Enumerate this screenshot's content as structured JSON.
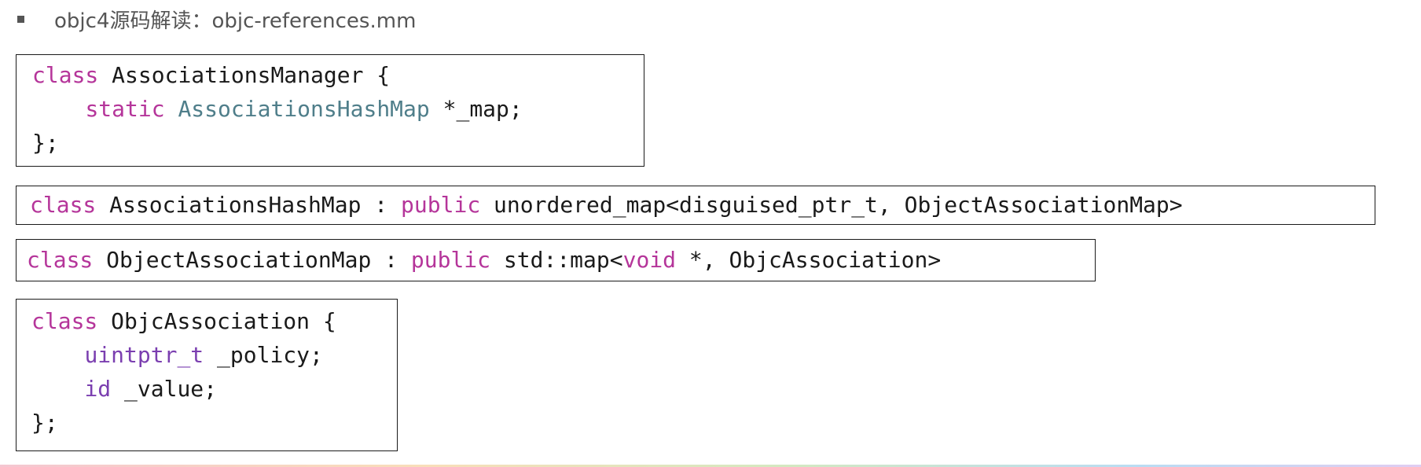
{
  "heading": {
    "text": "objc4源码解读：objc-references.mm"
  },
  "code_blocks": [
    {
      "lines": [
        [
          {
            "text": "class",
            "style": "kw"
          },
          {
            "text": " AssociationsManager {",
            "style": "plain"
          }
        ],
        [
          {
            "text": "    ",
            "style": "plain"
          },
          {
            "text": "static",
            "style": "kw"
          },
          {
            "text": " ",
            "style": "plain"
          },
          {
            "text": "AssociationsHashMap",
            "style": "type-teal"
          },
          {
            "text": " *_map;",
            "style": "plain"
          }
        ],
        [
          {
            "text": "};",
            "style": "plain"
          }
        ]
      ]
    },
    {
      "lines": [
        [
          {
            "text": "class",
            "style": "kw"
          },
          {
            "text": " AssociationsHashMap : ",
            "style": "plain"
          },
          {
            "text": "public",
            "style": "kw"
          },
          {
            "text": " unordered_map<disguised_ptr_t, ObjectAssociationMap>",
            "style": "plain"
          }
        ]
      ]
    },
    {
      "lines": [
        [
          {
            "text": "class",
            "style": "kw"
          },
          {
            "text": " ObjectAssociationMap : ",
            "style": "plain"
          },
          {
            "text": "public",
            "style": "kw"
          },
          {
            "text": " std::map<",
            "style": "plain"
          },
          {
            "text": "void",
            "style": "kw"
          },
          {
            "text": " *, ObjcAssociation>",
            "style": "plain"
          }
        ]
      ]
    },
    {
      "lines": [
        [
          {
            "text": "class",
            "style": "kw"
          },
          {
            "text": " ObjcAssociation {",
            "style": "plain"
          }
        ],
        [
          {
            "text": "    ",
            "style": "plain"
          },
          {
            "text": "uintptr_t",
            "style": "type-purple"
          },
          {
            "text": " _policy;",
            "style": "plain"
          }
        ],
        [
          {
            "text": "    ",
            "style": "plain"
          },
          {
            "text": "id",
            "style": "type-purple"
          },
          {
            "text": " _value;",
            "style": "plain"
          }
        ],
        [
          {
            "text": "};",
            "style": "plain"
          }
        ]
      ]
    }
  ],
  "colors": {
    "keyword": "#b5359a",
    "type_teal": "#4f7e8a",
    "type_purple": "#7b3fb0",
    "text": "#1a1a1a",
    "heading": "#555555"
  }
}
